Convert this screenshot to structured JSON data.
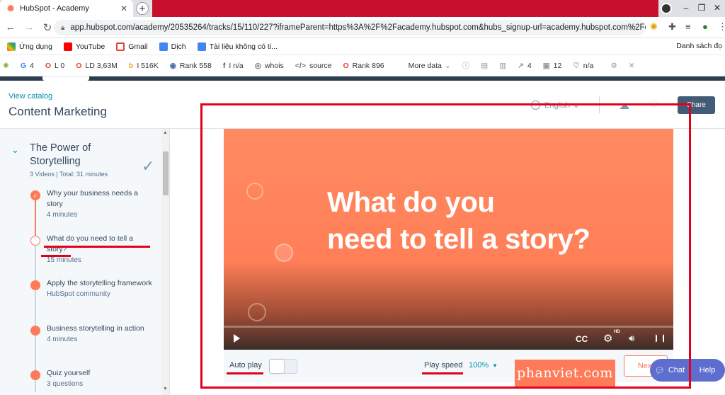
{
  "browser": {
    "tab_title": "HubSpot - Academy",
    "tab_close": "✕",
    "new_tab": "+",
    "url": "app.hubspot.com/academy/20535264/tracks/15/110/227?iframeParent=https%3A%2F%2Facademy.hubspot.com&hubs_signup-url=academy.hubspot.com%2Fco…",
    "bookmarks": [
      "Ứng dụng",
      "YouTube",
      "Gmail",
      "Dịch",
      "Tài liệu không có ti..."
    ],
    "bookmarks_right": "Danh sách đọ"
  },
  "seobar": {
    "items": [
      {
        "icon": "G",
        "value": "4"
      },
      {
        "icon": "O",
        "value": "L 0"
      },
      {
        "icon": "O",
        "value": "LD 3,63M"
      },
      {
        "icon": "b",
        "value": "I 516K"
      },
      {
        "icon": "◉",
        "value": "Rank 558"
      },
      {
        "icon": "f",
        "value": "I n/a"
      },
      {
        "icon": "◎",
        "value": "whois"
      },
      {
        "icon": "</>",
        "value": "source"
      },
      {
        "icon": "O",
        "value": "Rank 896"
      }
    ],
    "more": "More data",
    "right": [
      {
        "icon": "↗",
        "value": "4"
      },
      {
        "icon": "▣",
        "value": "12"
      },
      {
        "icon": "♡",
        "value": "n/a"
      }
    ]
  },
  "header": {
    "view_catalog": "View catalog",
    "course_title": "Content Marketing",
    "language": "English",
    "share": "Share"
  },
  "sidebar": {
    "section_title": "The Power of Storytelling",
    "section_meta": "3 Videos | Total: 31 minutes",
    "lessons": [
      {
        "title": "Why your business needs a story",
        "sub": "4 minutes"
      },
      {
        "title": "What do you need to tell a story?",
        "sub": "15 minutes"
      },
      {
        "title": "Apply the storytelling framework",
        "sub": "HubSpot community"
      },
      {
        "title": "Business storytelling in action",
        "sub": "4 minutes"
      },
      {
        "title": "Quiz yourself",
        "sub": "3 questions"
      }
    ]
  },
  "video": {
    "headline_line1": "What do you",
    "headline_line2": "need to tell a story?",
    "cc": "CC",
    "hd": "HD",
    "progress": 0
  },
  "controls": {
    "auto_play": "Auto play",
    "auto_play_on": false,
    "play_speed_label": "Play speed",
    "play_speed_value": "100%",
    "next": "Next"
  },
  "overlay": {
    "watermark": "phanviet.com",
    "chat": "Chat",
    "help": "Help"
  },
  "colors": {
    "accent_orange": "#ff7a59",
    "annotation_red": "#e3001b",
    "link_teal": "#0091ae",
    "share_button": "#425b76",
    "chat_purple": "#5e6ecf"
  }
}
